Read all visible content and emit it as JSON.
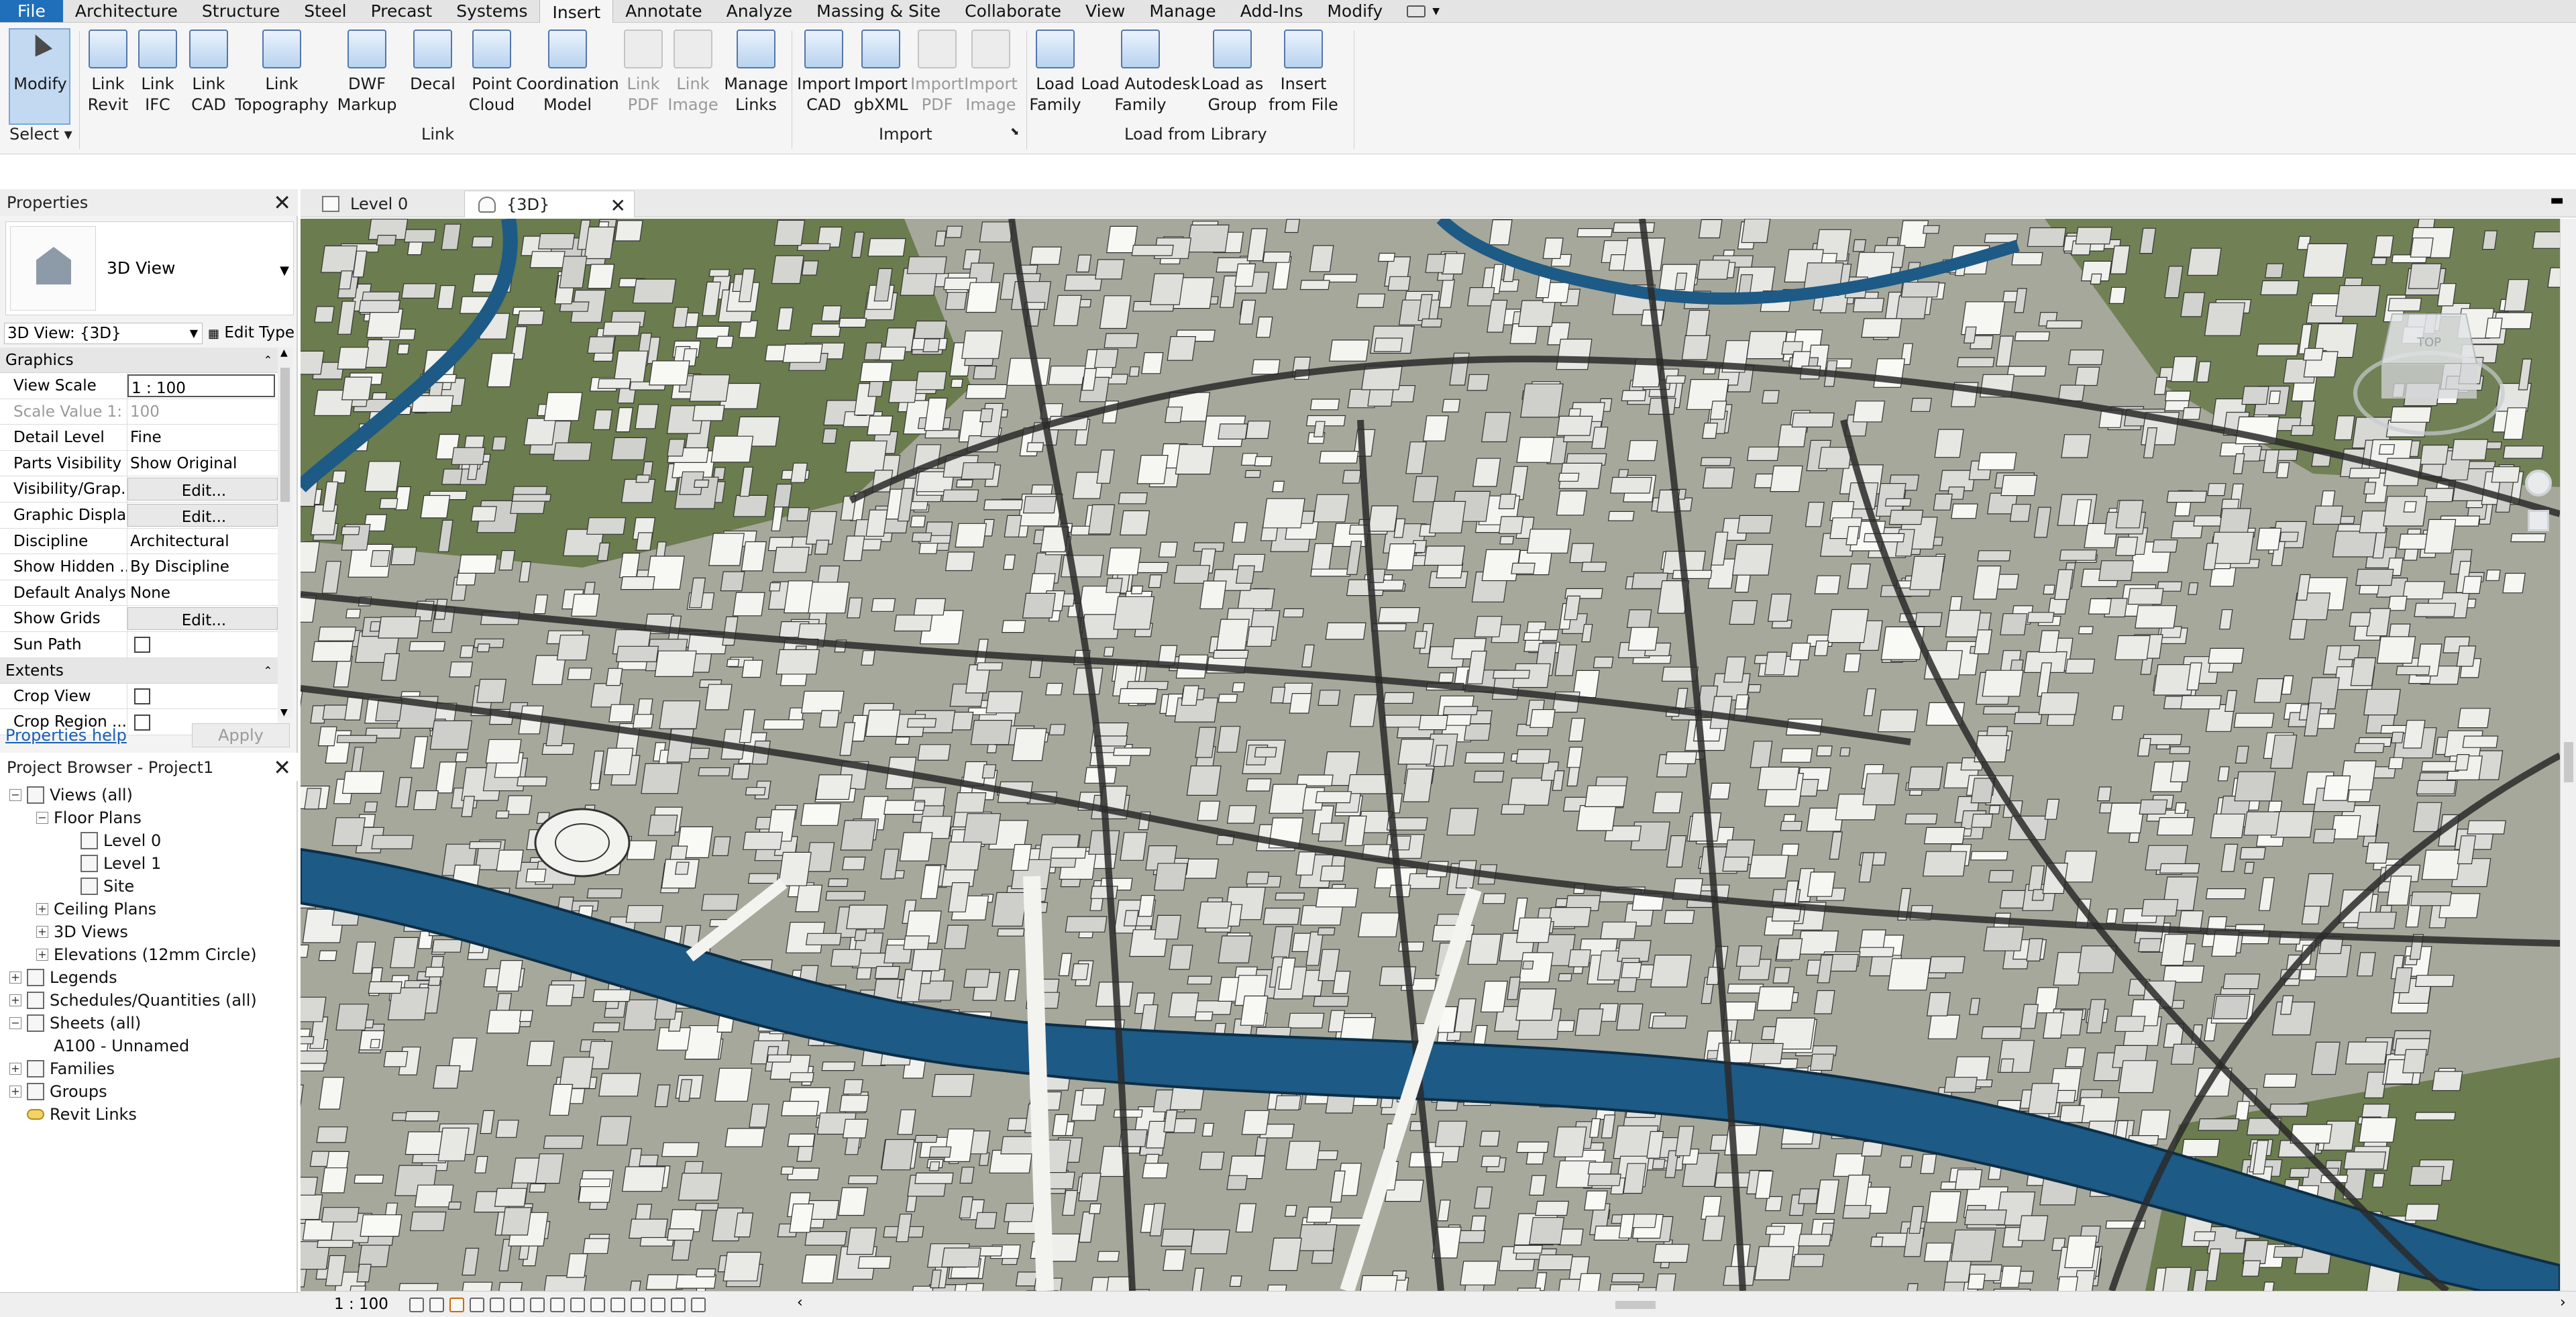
{
  "ribbon_tabs": [
    "File",
    "Architecture",
    "Structure",
    "Steel",
    "Precast",
    "Systems",
    "Insert",
    "Annotate",
    "Analyze",
    "Massing & Site",
    "Collaborate",
    "View",
    "Manage",
    "Add-Ins",
    "Modify"
  ],
  "active_tab": "Insert",
  "select_panel": {
    "modify_label": "Modify",
    "select_label": "Select"
  },
  "link_tools": [
    {
      "label": "Link\nRevit",
      "icon": "link-revit-icon"
    },
    {
      "label": "Link\nIFC",
      "icon": "link-ifc-icon"
    },
    {
      "label": "Link\nCAD",
      "icon": "link-cad-icon"
    },
    {
      "label": "Link\nTopography",
      "icon": "link-topography-icon"
    },
    {
      "label": "DWF\nMarkup",
      "icon": "dwf-markup-icon"
    },
    {
      "label": "Decal",
      "icon": "decal-icon"
    },
    {
      "label": "Point\nCloud",
      "icon": "point-cloud-icon"
    },
    {
      "label": "Coordination\nModel",
      "icon": "coordination-model-icon"
    },
    {
      "label": "Link\nPDF",
      "icon": "link-pdf-icon",
      "disabled": true
    },
    {
      "label": "Link\nImage",
      "icon": "link-image-icon",
      "disabled": true
    },
    {
      "label": "Manage\nLinks",
      "icon": "manage-links-icon"
    }
  ],
  "import_tools": [
    {
      "label": "Import\nCAD",
      "icon": "import-cad-icon"
    },
    {
      "label": "Import\ngbXML",
      "icon": "import-gbxml-icon"
    },
    {
      "label": "Import\nPDF",
      "icon": "import-pdf-icon",
      "disabled": true
    },
    {
      "label": "Import\nImage",
      "icon": "import-image-icon",
      "disabled": true
    }
  ],
  "library_tools": [
    {
      "label": "Load\nFamily",
      "icon": "load-family-icon"
    },
    {
      "label": "Load Autodesk\nFamily",
      "icon": "load-autodesk-family-icon"
    },
    {
      "label": "Load as\nGroup",
      "icon": "load-as-group-icon"
    },
    {
      "label": "Insert\nfrom File",
      "icon": "insert-from-file-icon"
    }
  ],
  "panels": {
    "link": "Link",
    "import": "Import",
    "library": "Load from Library"
  },
  "view_tabs": [
    {
      "label": "Level 0"
    },
    {
      "label": "{3D}"
    }
  ],
  "properties": {
    "title": "Properties",
    "type_name": "3D View",
    "instance": "3D View: {3D}",
    "edit_type": "Edit Type",
    "groups": [
      {
        "name": "Graphics",
        "rows": [
          {
            "name": "View Scale",
            "value": "1 : 100",
            "style": "boxed"
          },
          {
            "name": "Scale Value    1:",
            "value": "100",
            "dim": true
          },
          {
            "name": "Detail Level",
            "value": "Fine"
          },
          {
            "name": "Parts Visibility",
            "value": "Show Original"
          },
          {
            "name": "Visibility/Grap...",
            "value": "Edit...",
            "style": "edit"
          },
          {
            "name": "Graphic Displa...",
            "value": "Edit...",
            "style": "edit"
          },
          {
            "name": "Discipline",
            "value": "Architectural"
          },
          {
            "name": "Show Hidden ...",
            "value": "By Discipline"
          },
          {
            "name": "Default Analys...",
            "value": "None"
          },
          {
            "name": "Show Grids",
            "value": "Edit...",
            "style": "edit"
          },
          {
            "name": "Sun Path",
            "value": "",
            "style": "check"
          }
        ]
      },
      {
        "name": "Extents",
        "rows": [
          {
            "name": "Crop View",
            "value": "",
            "style": "check"
          },
          {
            "name": "Crop Region ...",
            "value": "",
            "style": "check"
          }
        ]
      }
    ],
    "help": "Properties help",
    "apply": "Apply"
  },
  "browser": {
    "title": "Project Browser - Project1",
    "items": [
      {
        "label": "Views (all)",
        "level": 0,
        "exp": "−",
        "icon": "views-icon"
      },
      {
        "label": "Floor Plans",
        "level": 1,
        "exp": "−"
      },
      {
        "label": "Level 0",
        "level": 2,
        "icon": "plan-icon"
      },
      {
        "label": "Level 1",
        "level": 2,
        "icon": "plan-icon"
      },
      {
        "label": "Site",
        "level": 2,
        "icon": "plan-icon"
      },
      {
        "label": "Ceiling Plans",
        "level": 1,
        "exp": "+"
      },
      {
        "label": "3D Views",
        "level": 1,
        "exp": "+"
      },
      {
        "label": "Elevations (12mm Circle)",
        "level": 1,
        "exp": "+"
      },
      {
        "label": "Legends",
        "level": 0,
        "exp": "+",
        "icon": "legends-icon"
      },
      {
        "label": "Schedules/Quantities (all)",
        "level": 0,
        "exp": "+",
        "icon": "schedules-icon"
      },
      {
        "label": "Sheets (all)",
        "level": 0,
        "exp": "−",
        "icon": "sheets-icon"
      },
      {
        "label": "A100 - Unnamed",
        "level": 1
      },
      {
        "label": "Families",
        "level": 0,
        "exp": "+",
        "icon": "families-icon"
      },
      {
        "label": "Groups",
        "level": 0,
        "exp": "+",
        "icon": "groups-icon"
      },
      {
        "label": "Revit Links",
        "level": 0,
        "icon": "revit-links-icon"
      }
    ]
  },
  "viewcube": {
    "face": "TOP"
  },
  "status": {
    "scale": "1 : 100"
  },
  "colors": {
    "river": "#1d5a85",
    "ground": "#a6a89b",
    "park": "#6b7c4e",
    "building": "#eeeeea",
    "road": "#2a2a2a",
    "accent": "#1f6fba"
  }
}
